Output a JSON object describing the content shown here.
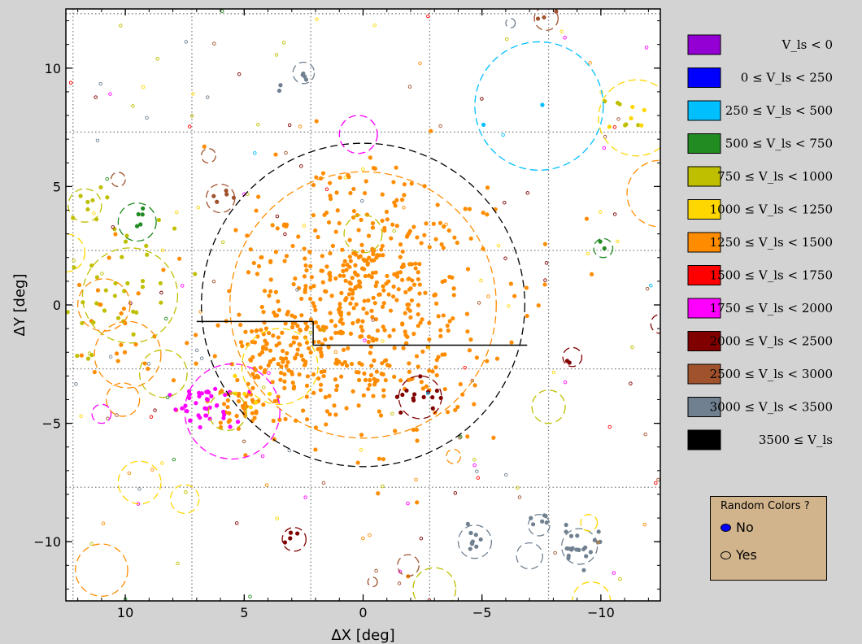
{
  "chart_data": {
    "type": "scatter",
    "title": "",
    "xlabel": "ΔX [deg]",
    "ylabel": "ΔY [deg]",
    "xlim": [
      12.5,
      -12.5
    ],
    "ylim": [
      -12.5,
      12.5
    ],
    "xticks": [
      {
        "value": 10,
        "label": "10"
      },
      {
        "value": 5,
        "label": "5"
      },
      {
        "value": 0,
        "label": "0"
      },
      {
        "value": -5,
        "label": "−5"
      },
      {
        "value": -10,
        "label": "−10"
      }
    ],
    "yticks": [
      {
        "value": 10,
        "label": "10"
      },
      {
        "value": 5,
        "label": "5"
      },
      {
        "value": 0,
        "label": "0"
      },
      {
        "value": -5,
        "label": "−5"
      },
      {
        "value": -10,
        "label": "−10"
      }
    ],
    "grid_x": [
      12.2,
      7.2,
      2.2,
      -2.8,
      -7.8
    ],
    "grid_y": [
      12.3,
      7.3,
      2.3,
      -2.7,
      -7.7
    ],
    "legend_placement": "right",
    "legend": [
      {
        "label": "V_ls < 0",
        "color": "#9400d3"
      },
      {
        "label": "0 ≤ V_ls < 250",
        "color": "#0000ff"
      },
      {
        "label": "250 ≤ V_ls < 500",
        "color": "#00bfff"
      },
      {
        "label": "500 ≤ V_ls < 750",
        "color": "#228b22"
      },
      {
        "label": "750 ≤ V_ls < 1000",
        "color": "#bfbf00"
      },
      {
        "label": "1000 ≤ V_ls < 1250",
        "color": "#ffd700"
      },
      {
        "label": "1250 ≤ V_ls < 1500",
        "color": "#ff8c00"
      },
      {
        "label": "1500 ≤ V_ls < 1750",
        "color": "#ff0000"
      },
      {
        "label": "1750 ≤ V_ls < 2000",
        "color": "#ff00ff"
      },
      {
        "label": "2000 ≤ V_ls < 2500",
        "color": "#800000"
      },
      {
        "label": "2500 ≤ V_ls < 3000",
        "color": "#a0522d"
      },
      {
        "label": "3000 ≤ V_ls < 3500",
        "color": "#708090"
      },
      {
        "label": "3500 ≤ V_ls",
        "color": "#000000"
      }
    ],
    "circles": [
      {
        "x": 0.0,
        "y": 0.0,
        "r": 6.8,
        "color": "#000000"
      },
      {
        "x": 0.0,
        "y": 0.0,
        "r": 5.6,
        "color": "#ff8c00"
      },
      {
        "x": -7.4,
        "y": 8.4,
        "r": 2.7,
        "color": "#00bfff"
      },
      {
        "x": -11.5,
        "y": 7.9,
        "r": 1.6,
        "color": "#ffd700"
      },
      {
        "x": -12.5,
        "y": 4.7,
        "r": 1.4,
        "color": "#ff8c00"
      },
      {
        "x": 0.2,
        "y": 7.2,
        "r": 0.8,
        "color": "#ff00ff"
      },
      {
        "x": 0.0,
        "y": 3.0,
        "r": 0.8,
        "color": "#bfbf00"
      },
      {
        "x": 9.8,
        "y": 0.4,
        "r": 2.0,
        "color": "#bfbf00"
      },
      {
        "x": 10.9,
        "y": 0.0,
        "r": 1.1,
        "color": "#ff8c00"
      },
      {
        "x": 9.9,
        "y": -2.1,
        "r": 1.4,
        "color": "#ff8c00"
      },
      {
        "x": 8.4,
        "y": -2.9,
        "r": 1.0,
        "color": "#bfbf00"
      },
      {
        "x": 10.1,
        "y": -4.0,
        "r": 0.7,
        "color": "#ff8c00"
      },
      {
        "x": 11.7,
        "y": 4.2,
        "r": 0.7,
        "color": "#bfbf00"
      },
      {
        "x": 9.5,
        "y": 3.5,
        "r": 0.8,
        "color": "#228b22"
      },
      {
        "x": 12.5,
        "y": 2.2,
        "r": 0.8,
        "color": "#ffd700"
      },
      {
        "x": 5.5,
        "y": -4.5,
        "r": 2.0,
        "color": "#ff00ff"
      },
      {
        "x": 3.5,
        "y": -2.6,
        "r": 1.6,
        "color": "#ffd700"
      },
      {
        "x": 5.7,
        "y": -4.5,
        "r": 0.8,
        "color": "#bfbf00"
      },
      {
        "x": 9.4,
        "y": -7.5,
        "r": 0.9,
        "color": "#ffd700"
      },
      {
        "x": 7.5,
        "y": -8.2,
        "r": 0.6,
        "color": "#ffd700"
      },
      {
        "x": 11.0,
        "y": -11.2,
        "r": 1.1,
        "color": "#ff8c00"
      },
      {
        "x": 11.0,
        "y": -4.6,
        "r": 0.4,
        "color": "#ff00ff"
      },
      {
        "x": 6.0,
        "y": 4.5,
        "r": 0.6,
        "color": "#a0522d"
      },
      {
        "x": 6.5,
        "y": 6.3,
        "r": 0.3,
        "color": "#a0522d"
      },
      {
        "x": 10.3,
        "y": 5.3,
        "r": 0.3,
        "color": "#a0522d"
      },
      {
        "x": 2.5,
        "y": 9.8,
        "r": 0.45,
        "color": "#708090"
      },
      {
        "x": 2.9,
        "y": -9.9,
        "r": 0.5,
        "color": "#800000"
      },
      {
        "x": -2.4,
        "y": -3.9,
        "r": 0.9,
        "color": "#800000"
      },
      {
        "x": -3.8,
        "y": -6.4,
        "r": 0.3,
        "color": "#ff8c00"
      },
      {
        "x": -7.8,
        "y": -4.3,
        "r": 0.7,
        "color": "#bfbf00"
      },
      {
        "x": -8.8,
        "y": -2.2,
        "r": 0.4,
        "color": "#800000"
      },
      {
        "x": -10.1,
        "y": 2.4,
        "r": 0.4,
        "color": "#228b22"
      },
      {
        "x": -12.5,
        "y": -0.8,
        "r": 0.4,
        "color": "#800000"
      },
      {
        "x": -4.7,
        "y": -10.0,
        "r": 0.7,
        "color": "#708090"
      },
      {
        "x": -7.0,
        "y": -10.6,
        "r": 0.55,
        "color": "#708090"
      },
      {
        "x": -7.4,
        "y": -9.3,
        "r": 0.45,
        "color": "#708090"
      },
      {
        "x": -9.1,
        "y": -10.2,
        "r": 0.75,
        "color": "#708090"
      },
      {
        "x": -9.5,
        "y": -9.2,
        "r": 0.35,
        "color": "#ffd700"
      },
      {
        "x": -9.6,
        "y": -12.5,
        "r": 0.8,
        "color": "#ffd700"
      },
      {
        "x": -3.0,
        "y": -12.0,
        "r": 0.9,
        "color": "#bfbf00"
      },
      {
        "x": -1.9,
        "y": -11.0,
        "r": 0.45,
        "color": "#a0522d"
      },
      {
        "x": -0.4,
        "y": -11.7,
        "r": 0.2,
        "color": "#a0522d"
      },
      {
        "x": -7.7,
        "y": 12.1,
        "r": 0.5,
        "color": "#a0522d"
      },
      {
        "x": -6.2,
        "y": 11.9,
        "r": 0.2,
        "color": "#708090"
      }
    ],
    "boundary_line": [
      [
        7.0,
        -0.7
      ],
      [
        2.1,
        -0.7
      ],
      [
        2.1,
        -1.7
      ],
      [
        -6.9,
        -1.7
      ]
    ],
    "series": [
      {
        "color": "#ff8c00",
        "filled": true,
        "cluster": [
          {
            "x": 0.0,
            "y": -0.2,
            "sx": 2.2,
            "sy": 2.4,
            "n": 320
          },
          {
            "x": 3.4,
            "y": -2.4,
            "sx": 1.1,
            "sy": 1.0,
            "n": 90
          },
          {
            "x": 5.1,
            "y": -4.4,
            "sx": 0.6,
            "sy": 0.5,
            "n": 45
          },
          {
            "x": 0.0,
            "y": 0.6,
            "sx": 3.3,
            "sy": 3.0,
            "n": 230
          },
          {
            "x": 10.0,
            "y": -0.7,
            "sx": 1.2,
            "sy": 1.5,
            "n": 25
          }
        ]
      },
      {
        "color": "#ff00ff",
        "filled": true,
        "cluster": [
          {
            "x": 6.6,
            "y": -4.2,
            "sx": 0.7,
            "sy": 0.5,
            "n": 40
          }
        ]
      },
      {
        "color": "#bfbf00",
        "filled": true,
        "cluster": [
          {
            "x": 9.8,
            "y": 0.8,
            "sx": 1.5,
            "sy": 1.6,
            "n": 40
          },
          {
            "x": 11.7,
            "y": 4.2,
            "sx": 0.4,
            "sy": 0.4,
            "n": 6
          },
          {
            "x": -11.5,
            "y": 8.2,
            "sx": 0.6,
            "sy": 0.4,
            "n": 6
          }
        ]
      },
      {
        "color": "#800000",
        "filled": true,
        "cluster": [
          {
            "x": -2.3,
            "y": -3.9,
            "sx": 0.5,
            "sy": 0.5,
            "n": 14
          },
          {
            "x": 2.9,
            "y": -9.9,
            "sx": 0.2,
            "sy": 0.2,
            "n": 4
          },
          {
            "x": -8.8,
            "y": -2.2,
            "sx": 0.15,
            "sy": 0.15,
            "n": 2
          }
        ]
      },
      {
        "color": "#708090",
        "filled": true,
        "cluster": [
          {
            "x": -9.1,
            "y": -10.2,
            "sx": 0.4,
            "sy": 0.45,
            "n": 22
          },
          {
            "x": -4.7,
            "y": -10.0,
            "sx": 0.35,
            "sy": 0.35,
            "n": 10
          },
          {
            "x": -7.4,
            "y": -9.2,
            "sx": 0.25,
            "sy": 0.3,
            "n": 6
          },
          {
            "x": 2.5,
            "y": 9.8,
            "sx": 0.2,
            "sy": 0.2,
            "n": 4
          },
          {
            "x": 3.5,
            "y": 9.2,
            "sx": 0.1,
            "sy": 0.1,
            "n": 2
          }
        ]
      },
      {
        "color": "#a0522d",
        "filled": true,
        "cluster": [
          {
            "x": 6.0,
            "y": 4.5,
            "sx": 0.25,
            "sy": 0.2,
            "n": 5
          },
          {
            "x": -7.7,
            "y": 12.1,
            "sx": 0.2,
            "sy": 0.2,
            "n": 3
          }
        ]
      },
      {
        "color": "#228b22",
        "filled": true,
        "cluster": [
          {
            "x": 9.5,
            "y": 3.5,
            "sx": 0.35,
            "sy": 0.3,
            "n": 5
          },
          {
            "x": -10.1,
            "y": 2.4,
            "sx": 0.15,
            "sy": 0.15,
            "n": 2
          }
        ]
      },
      {
        "color": "#00bfff",
        "filled": true,
        "cluster": [
          {
            "x": -7.5,
            "y": 8.4,
            "sx": 0.05,
            "sy": 0.05,
            "n": 1
          },
          {
            "x": -5.0,
            "y": 7.6,
            "sx": 0.05,
            "sy": 0.05,
            "n": 1
          }
        ]
      },
      {
        "color": "#ffd700",
        "filled": true,
        "cluster": [
          {
            "x": -11.5,
            "y": 7.9,
            "sx": 0.5,
            "sy": 0.4,
            "n": 5
          },
          {
            "x": 4.8,
            "y": -4.0,
            "sx": 0.6,
            "sy": 0.6,
            "n": 6
          }
        ]
      },
      {
        "color": "#a0522d",
        "filled": false,
        "cluster": [
          {
            "x": 0.0,
            "y": 0.0,
            "sx": 7.0,
            "sy": 7.0,
            "n": 22
          }
        ]
      },
      {
        "color": "#ffd700",
        "filled": false,
        "cluster": [
          {
            "x": 0.0,
            "y": 0.0,
            "sx": 7.0,
            "sy": 7.0,
            "n": 26
          }
        ]
      },
      {
        "color": "#bfbf00",
        "filled": false,
        "cluster": [
          {
            "x": 0.0,
            "y": 0.0,
            "sx": 7.0,
            "sy": 7.0,
            "n": 26
          }
        ]
      },
      {
        "color": "#ff00ff",
        "filled": false,
        "cluster": [
          {
            "x": 0.0,
            "y": 0.0,
            "sx": 7.0,
            "sy": 7.0,
            "n": 16
          }
        ]
      },
      {
        "color": "#800000",
        "filled": false,
        "cluster": [
          {
            "x": 0.0,
            "y": 0.0,
            "sx": 7.0,
            "sy": 7.0,
            "n": 22
          }
        ]
      },
      {
        "color": "#708090",
        "filled": false,
        "cluster": [
          {
            "x": 0.0,
            "y": 0.0,
            "sx": 7.0,
            "sy": 7.0,
            "n": 16
          }
        ]
      },
      {
        "color": "#ff8c00",
        "filled": false,
        "cluster": [
          {
            "x": 0.0,
            "y": 0.0,
            "sx": 7.0,
            "sy": 7.0,
            "n": 18
          }
        ]
      },
      {
        "color": "#228b22",
        "filled": false,
        "cluster": [
          {
            "x": 0.0,
            "y": 0.0,
            "sx": 7.0,
            "sy": 7.0,
            "n": 8
          }
        ]
      },
      {
        "color": "#ff0000",
        "filled": false,
        "cluster": [
          {
            "x": 0.0,
            "y": 0.0,
            "sx": 7.0,
            "sy": 7.0,
            "n": 10
          }
        ]
      },
      {
        "color": "#00bfff",
        "filled": false,
        "cluster": [
          {
            "x": 0.0,
            "y": 0.0,
            "sx": 7.0,
            "sy": 7.0,
            "n": 4
          }
        ]
      }
    ]
  },
  "radio": {
    "title": "Random Colors ?",
    "options": [
      {
        "label": "No",
        "selected": true
      },
      {
        "label": "Yes",
        "selected": false
      }
    ]
  }
}
